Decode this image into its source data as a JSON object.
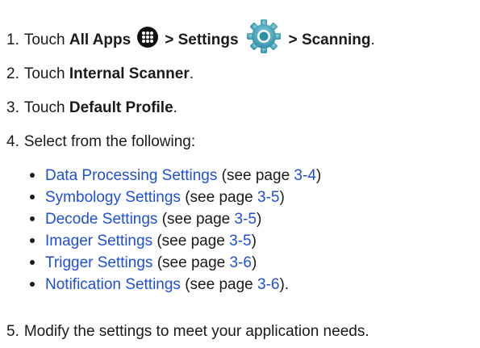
{
  "steps": {
    "step1": {
      "num": "1.",
      "touch": "Touch",
      "all_apps": "All Apps",
      "sep1": "> ",
      "settings": "Settings",
      "sep2": "> ",
      "scanning": "Scanning",
      "end": ".",
      "icons": [
        "apps-icon",
        "settings-gear-icon"
      ]
    },
    "step2": {
      "num": "2.",
      "touch": "Touch",
      "target": "Internal Scanner",
      "end": "."
    },
    "step3": {
      "num": "3.",
      "touch": "Touch",
      "target": "Default Profile",
      "end": "."
    },
    "step4": {
      "num": "4.",
      "text": "Select from the following:"
    },
    "step5": {
      "num": "5.",
      "text": "Modify the settings to meet your application needs."
    }
  },
  "options": [
    {
      "link": "Data Processing Settings",
      "pre": " (see page ",
      "page": "3-4",
      "post": ")"
    },
    {
      "link": "Symbology Settings",
      "pre": " (see page ",
      "page": "3-5",
      "post": ")"
    },
    {
      "link": "Decode Settings",
      "pre": " (see page ",
      "page": "3-5",
      "post": ")"
    },
    {
      "link": "Imager Settings",
      "pre": " (see page ",
      "page": "3-5",
      "post": ")"
    },
    {
      "link": "Trigger Settings",
      "pre": " (see page ",
      "page": "3-6",
      "post": ")"
    },
    {
      "link": "Notification Settings",
      "pre": " (see page ",
      "page": "3-6",
      "post": ")."
    }
  ],
  "colors": {
    "link": "#1f4fd6",
    "text": "#1a1a1a",
    "gear": "#3e9ab0"
  }
}
